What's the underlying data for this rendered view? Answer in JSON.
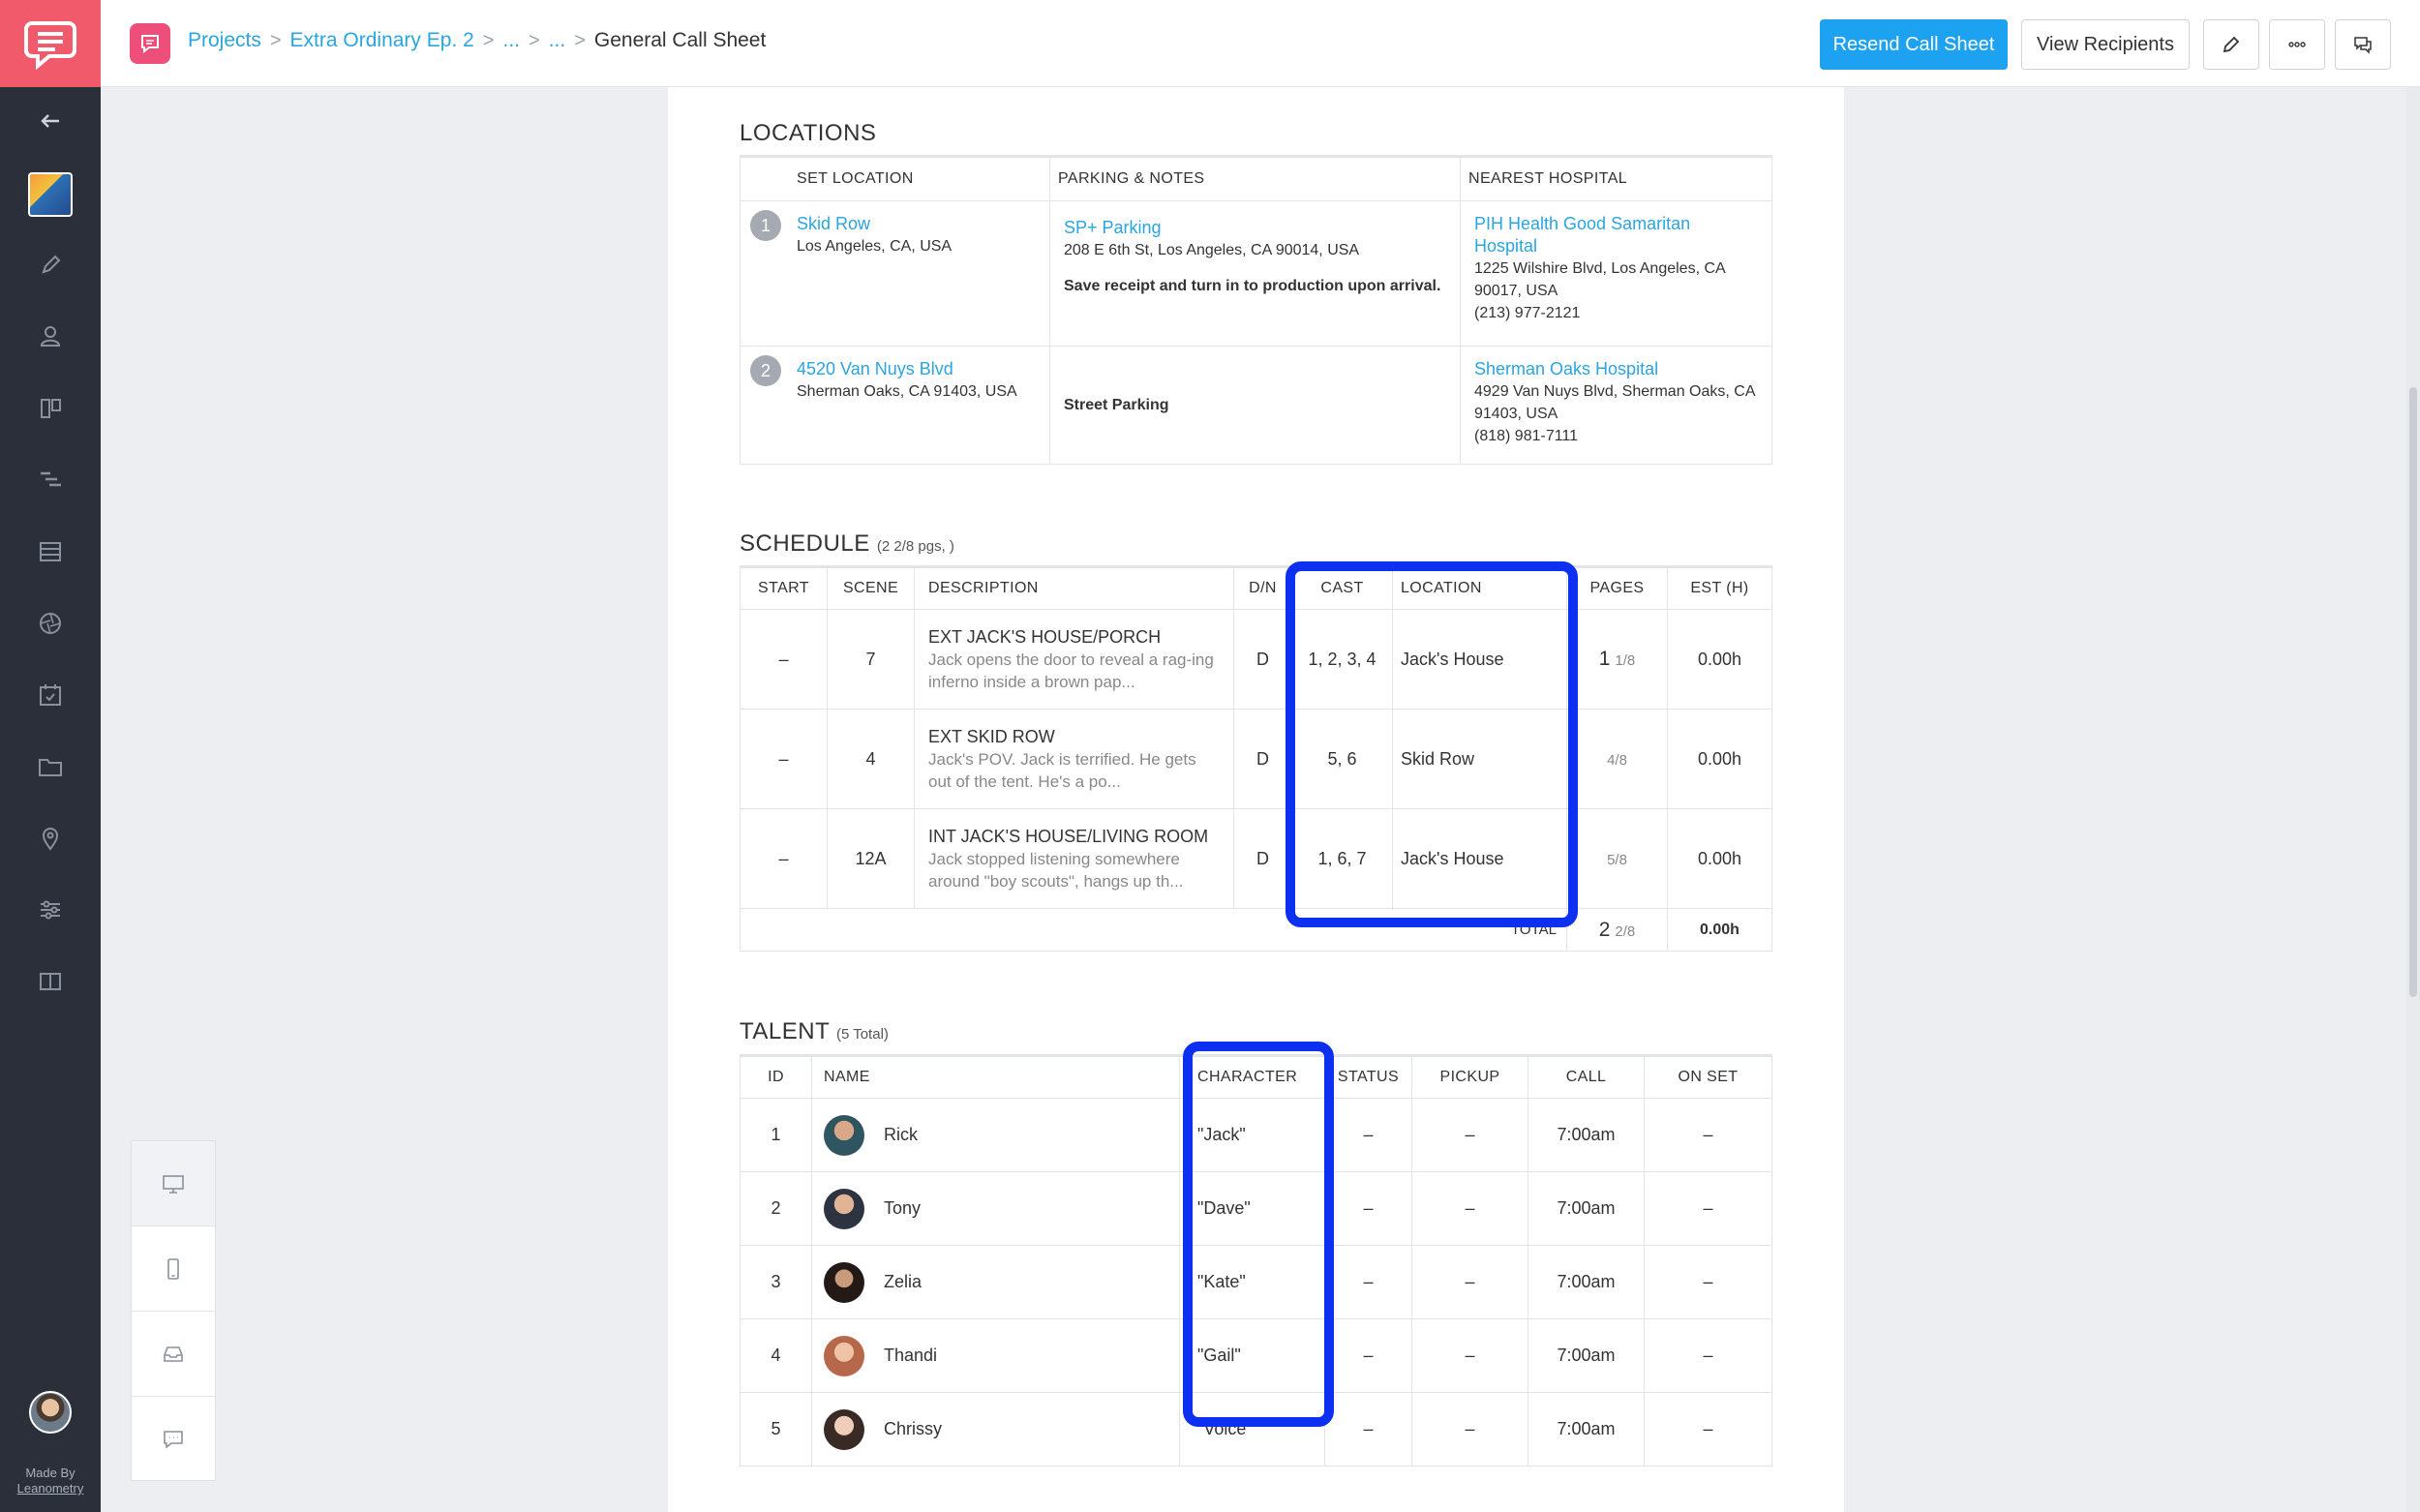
{
  "app": {
    "made_by_line1": "Made By",
    "made_by_line2": "Leanometry"
  },
  "header": {
    "breadcrumb": [
      "Projects",
      "Extra Ordinary Ep. 2",
      "...",
      "..."
    ],
    "current": "General Call Sheet",
    "resend_label": "Resend Call Sheet",
    "view_recipients_label": "View Recipients"
  },
  "locations": {
    "title": "LOCATIONS",
    "headers": [
      "SET LOCATION",
      "PARKING & NOTES",
      "NEAREST HOSPITAL"
    ],
    "rows": [
      {
        "num": "1",
        "set_name": "Skid Row",
        "set_address": "Los Angeles, CA, USA",
        "parking_name": "SP+ Parking",
        "parking_address": "208 E 6th St, Los Angeles, CA 90014, USA",
        "parking_note": "Save receipt and turn in to production upon arrival.",
        "hospital_name": "PIH Health Good Samaritan Hospital",
        "hospital_address": "1225 Wilshire Blvd, Los Angeles, CA 90017, USA",
        "hospital_phone": "(213) 977-2121"
      },
      {
        "num": "2",
        "set_name": "4520 Van Nuys Blvd",
        "set_address": "Sherman Oaks, CA 91403, USA",
        "parking_note": "Street Parking",
        "hospital_name": "Sherman Oaks Hospital",
        "hospital_address": "4929 Van Nuys Blvd, Sherman Oaks, CA 91403, USA",
        "hospital_phone": "(818) 981-7111"
      }
    ]
  },
  "schedule": {
    "title": "SCHEDULE",
    "subtitle": "(2 2/8 pgs, )",
    "headers": [
      "START",
      "SCENE",
      "DESCRIPTION",
      "D/N",
      "CAST",
      "LOCATION",
      "PAGES",
      "EST (H)"
    ],
    "rows": [
      {
        "start": "–",
        "scene": "7",
        "desc_title": "EXT JACK'S HOUSE/PORCH",
        "desc_body": "Jack opens the door to reveal a rag-ing inferno inside a brown pap...",
        "dn": "D",
        "cast": "1, 2, 3, 4",
        "location": "Jack's House",
        "pages_whole": "1",
        "pages_frac": "1/8",
        "est": "0.00h"
      },
      {
        "start": "–",
        "scene": "4",
        "desc_title": "EXT SKID ROW",
        "desc_body": "Jack's POV. Jack is terrified. He gets out of the tent. He's a po...",
        "dn": "D",
        "cast": "5, 6",
        "location": "Skid Row",
        "pages_whole": "",
        "pages_frac": "4/8",
        "est": "0.00h"
      },
      {
        "start": "–",
        "scene": "12A",
        "desc_title": "INT JACK'S HOUSE/LIVING ROOM",
        "desc_body": "Jack stopped listening somewhere around \"boy scouts\", hangs up th...",
        "dn": "D",
        "cast": "1, 6, 7",
        "location": "Jack's House",
        "pages_whole": "",
        "pages_frac": "5/8",
        "est": "0.00h"
      }
    ],
    "total_label": "TOTAL",
    "total_whole": "2",
    "total_frac": "2/8",
    "total_est": "0.00h"
  },
  "talent": {
    "title": "TALENT",
    "subtitle": "(5 Total)",
    "headers": [
      "ID",
      "NAME",
      "CHARACTER",
      "STATUS",
      "PICKUP",
      "CALL",
      "ON SET"
    ],
    "rows": [
      {
        "id": "1",
        "name": "Rick",
        "character": "\"Jack\"",
        "status": "–",
        "pickup": "–",
        "call": "7:00am",
        "onset": "–"
      },
      {
        "id": "2",
        "name": "Tony",
        "character": "\"Dave\"",
        "status": "–",
        "pickup": "–",
        "call": "7:00am",
        "onset": "–"
      },
      {
        "id": "3",
        "name": "Zelia",
        "character": "\"Kate\"",
        "status": "–",
        "pickup": "–",
        "call": "7:00am",
        "onset": "–"
      },
      {
        "id": "4",
        "name": "Thandi",
        "character": "\"Gail\"",
        "status": "–",
        "pickup": "–",
        "call": "7:00am",
        "onset": "–"
      },
      {
        "id": "5",
        "name": "Chrissy",
        "character": "\"Voice\"",
        "status": "–",
        "pickup": "–",
        "call": "7:00am",
        "onset": "–"
      }
    ]
  },
  "colors": {
    "accent": "#1da2f2",
    "link": "#2aa5de",
    "logo": "#f05a6b",
    "highlight": "#0d2ff0"
  },
  "icons": {
    "sidebar": [
      "back-arrow-icon",
      "project-thumbnail",
      "pencil-icon",
      "people-icon",
      "board-icon",
      "gantt-icon",
      "list-icon",
      "aperture-icon",
      "calendar-icon",
      "folder-icon",
      "map-pin-icon",
      "sliders-icon",
      "book-icon"
    ],
    "toolbar": [
      "edit-icon",
      "more-icon",
      "comments-icon"
    ],
    "device_panel": [
      "desktop-icon",
      "mobile-icon",
      "inbox-icon",
      "chat-icon"
    ]
  }
}
